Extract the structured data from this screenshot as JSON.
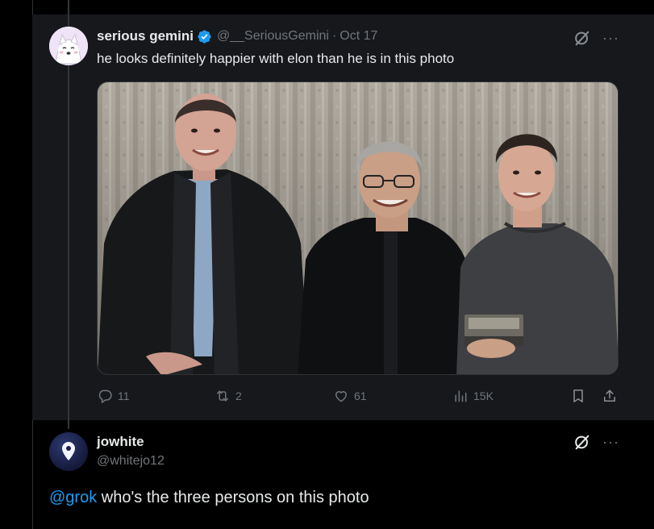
{
  "tweet": {
    "author_name": "serious gemini",
    "author_handle": "@__SeriousGemini",
    "separator": "·",
    "date": "Oct 17",
    "text": "he looks definitely happier with elon than he is in this photo",
    "more": "···",
    "stats": {
      "replies": "11",
      "reposts": "2",
      "likes": "61",
      "views": "15K"
    }
  },
  "reply": {
    "author_name": "jowhite",
    "author_handle": "@whitejo12",
    "mention": "@grok",
    "text": " who's the three persons on this photo",
    "more": "···"
  },
  "colors": {
    "background": "#000000",
    "card": "#16181c",
    "text": "#e7e9ea",
    "muted": "#71767b",
    "accent": "#1d9bf0"
  },
  "icons": [
    "verified-badge-icon",
    "grok-icon",
    "more-icon",
    "reply-icon",
    "repost-icon",
    "like-icon",
    "views-icon",
    "bookmark-icon",
    "share-icon",
    "location-pin-icon"
  ]
}
